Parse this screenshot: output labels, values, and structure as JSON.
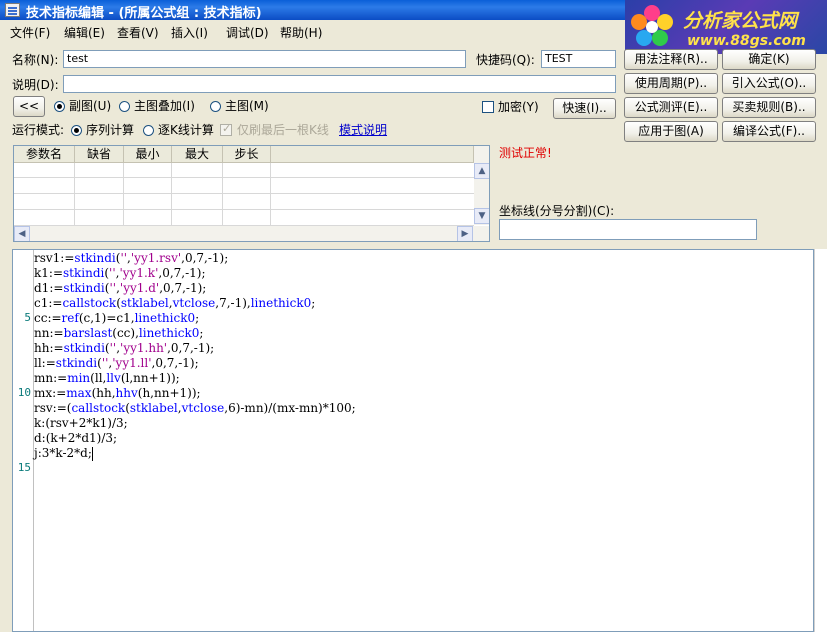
{
  "window": {
    "title": "技术指标编辑 - (所属公式组 : 技术指标)"
  },
  "banner": {
    "brand": "分析家公式网",
    "url": "www.88gs.com"
  },
  "menu": [
    {
      "label": "文件(F)"
    },
    {
      "label": "编辑(E)"
    },
    {
      "label": "查看(V)"
    },
    {
      "label": "插入(I)"
    },
    {
      "label": "调试(D)"
    },
    {
      "label": "帮助(H)"
    }
  ],
  "form": {
    "name_label": "名称(N):",
    "name_value": "test",
    "shortcut_label": "快捷码(Q):",
    "shortcut_value": "TEST",
    "desc_label": "说明(D):",
    "desc_value": "",
    "collapse_label": "<<",
    "radio_sub": "副图(U)",
    "radio_overlay": "主图叠加(I)",
    "radio_main": "主图(M)",
    "encrypt_label": "加密(Y)",
    "quick_label": "快速(I)..",
    "run_mode_label": "运行模式:",
    "mode_seq": "序列计算",
    "mode_kline": "逐K线计算",
    "refresh_last": "仅刷最后一根K线",
    "mode_help": "模式说明"
  },
  "buttons": {
    "usage": "用法注释(R)..",
    "ok": "确定(K)",
    "period": "使用周期(P)..",
    "import": "引入公式(O)..",
    "test": "公式测评(E)..",
    "trade": "买卖规则(B)..",
    "apply": "应用于图(A)",
    "compile": "编译公式(F).."
  },
  "status": {
    "test_message": "测试正常!",
    "coord_label": "坐标线(分号分割)(C):",
    "coord_value": ""
  },
  "param_table": {
    "headers": [
      "参数名",
      "缺省",
      "最小",
      "最大",
      "步长"
    ]
  },
  "editor": {
    "line_numbers": [
      "5",
      "10",
      "15"
    ],
    "lines": [
      [
        [
          "rsv1:=",
          ""
        ],
        [
          "stkindi",
          "kw"
        ],
        [
          "(",
          ""
        ],
        [
          "''",
          "str"
        ],
        [
          ",",
          ""
        ],
        [
          "'yy1.rsv'",
          "str"
        ],
        [
          ",0,7,-1);",
          ""
        ]
      ],
      [
        [
          "k1:=",
          ""
        ],
        [
          "stkindi",
          "kw"
        ],
        [
          "(",
          ""
        ],
        [
          "''",
          "str"
        ],
        [
          ",",
          ""
        ],
        [
          "'yy1.k'",
          "str"
        ],
        [
          ",0,7,-1);",
          ""
        ]
      ],
      [
        [
          "d1:=",
          ""
        ],
        [
          "stkindi",
          "kw"
        ],
        [
          "(",
          ""
        ],
        [
          "''",
          "str"
        ],
        [
          ",",
          ""
        ],
        [
          "'yy1.d'",
          "str"
        ],
        [
          ",0,7,-1);",
          ""
        ]
      ],
      [
        [
          "c1:=",
          ""
        ],
        [
          "callstock",
          "kw"
        ],
        [
          "(",
          ""
        ],
        [
          "stklabel",
          "kw"
        ],
        [
          ",",
          ""
        ],
        [
          "vtclose",
          "kw"
        ],
        [
          ",7,-1),",
          ""
        ],
        [
          "linethick0",
          "kw"
        ],
        [
          ";",
          ""
        ]
      ],
      [
        [
          "cc:=",
          ""
        ],
        [
          "ref",
          "kw"
        ],
        [
          "(c,1)=c1,",
          ""
        ],
        [
          "linethick0",
          "kw"
        ],
        [
          ";",
          ""
        ]
      ],
      [
        [
          "nn:=",
          ""
        ],
        [
          "barslast",
          "kw"
        ],
        [
          "(cc),",
          ""
        ],
        [
          "linethick0",
          "kw"
        ],
        [
          ";",
          ""
        ]
      ],
      [
        [
          "hh:=",
          ""
        ],
        [
          "stkindi",
          "kw"
        ],
        [
          "(",
          ""
        ],
        [
          "''",
          "str"
        ],
        [
          ",",
          ""
        ],
        [
          "'yy1.hh'",
          "str"
        ],
        [
          ",0,7,-1);",
          ""
        ]
      ],
      [
        [
          "ll:=",
          ""
        ],
        [
          "stkindi",
          "kw"
        ],
        [
          "(",
          ""
        ],
        [
          "''",
          "str"
        ],
        [
          ",",
          ""
        ],
        [
          "'yy1.ll'",
          "str"
        ],
        [
          ",0,7,-1);",
          ""
        ]
      ],
      [
        [
          "mn:=",
          ""
        ],
        [
          "min",
          "kw"
        ],
        [
          "(ll,",
          ""
        ],
        [
          "llv",
          "kw"
        ],
        [
          "(l,nn+1));",
          ""
        ]
      ],
      [
        [
          "mx:=",
          ""
        ],
        [
          "max",
          "kw"
        ],
        [
          "(hh,",
          ""
        ],
        [
          "hhv",
          "kw"
        ],
        [
          "(h,nn+1));",
          ""
        ]
      ],
      [
        [
          "rsv:=(",
          ""
        ],
        [
          "callstock",
          "kw"
        ],
        [
          "(",
          ""
        ],
        [
          "stklabel",
          "kw"
        ],
        [
          ",",
          ""
        ],
        [
          "vtclose",
          "kw"
        ],
        [
          ",6)-mn)/(mx-mn)*100;",
          ""
        ]
      ],
      [
        [
          "k:(rsv+2*k1)/3;",
          ""
        ]
      ],
      [
        [
          "d:(k+2*d1)/3;",
          ""
        ]
      ],
      [
        [
          "j:3*k-2*d;",
          ""
        ]
      ]
    ]
  }
}
